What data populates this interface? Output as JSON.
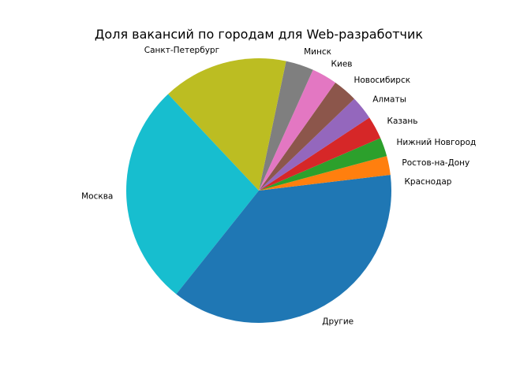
{
  "chart_data": {
    "type": "pie",
    "title": "Доля вакансий по городам для Web-разработчик",
    "categories": [
      "Краснодар",
      "Ростов-на-Дону",
      "Нижний Новгород",
      "Казань",
      "Алматы",
      "Новосибирск",
      "Киев",
      "Минск",
      "Санкт-Петербург",
      "Москва",
      "Другие"
    ],
    "values": [
      1.9,
      2.3,
      2.3,
      2.8,
      2.9,
      3.0,
      3.1,
      3.4,
      15.3,
      27.3,
      35.7
    ],
    "colors": [
      "#1f77b4",
      "#ff7f0e",
      "#2ca02c",
      "#d62728",
      "#9467bd",
      "#8c564b",
      "#e377c2",
      "#7f7f7f",
      "#bcbd22",
      "#17becf",
      "#1f77b4"
    ],
    "start_angle_deg": 0,
    "direction": "counterclockwise",
    "legend": "none"
  }
}
